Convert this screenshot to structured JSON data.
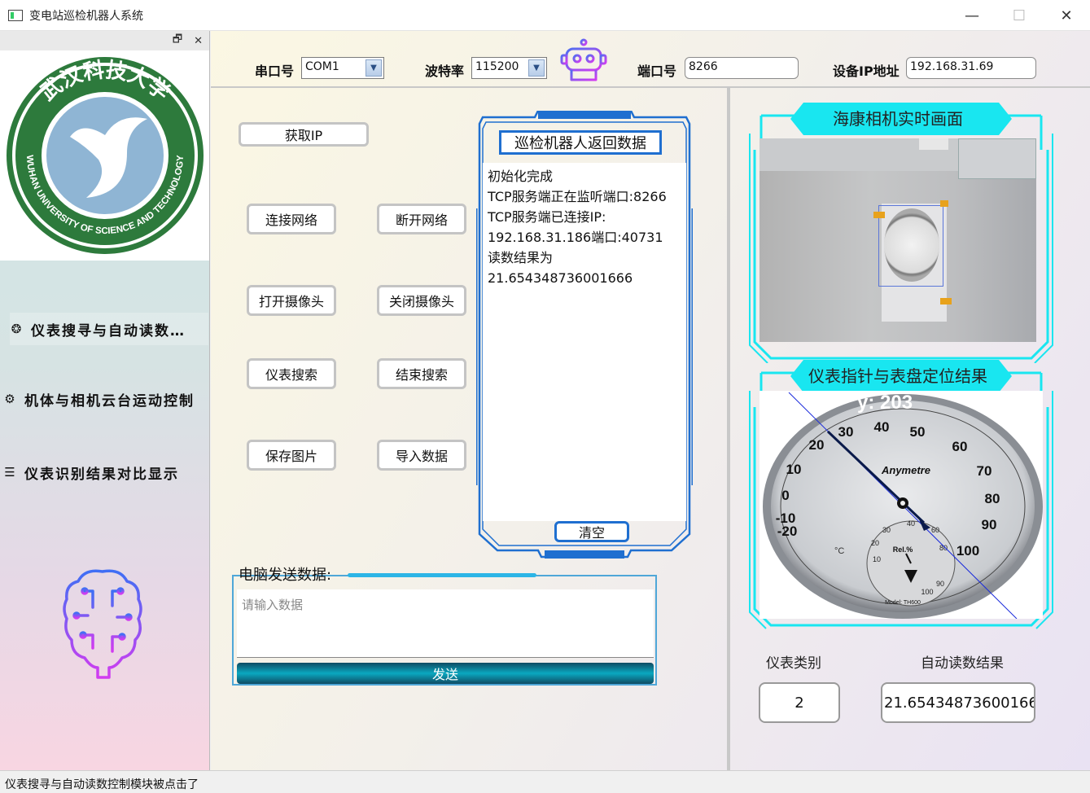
{
  "window": {
    "title": "变电站巡检机器人系统",
    "minimize": "—",
    "maximize": "☐",
    "close": "✕"
  },
  "sidebar": {
    "dock_restore": "🗗",
    "dock_close": "✕",
    "logo": {
      "top_text": "武汉科技大学",
      "ring_text": "WUHAN UNIVERSITY OF SCIENCE AND TECHNOLOGY"
    },
    "items": [
      {
        "label": "仪表搜寻与自动读数…",
        "icon": "brain-chip-icon",
        "glyph": "❂"
      },
      {
        "label": "机体与相机云台运动控制",
        "icon": "gears-icon",
        "glyph": "⚙"
      },
      {
        "label": "仪表识别结果对比显示",
        "icon": "list-icon",
        "glyph": "☰"
      }
    ]
  },
  "topbar": {
    "serial_label": "串口号",
    "serial_value": "COM1",
    "baud_label": "波特率",
    "baud_value": "115200",
    "port_label": "端口号",
    "port_value": "8266",
    "ip_label": "设备IP地址",
    "ip_value": "192.168.31.69"
  },
  "controls": {
    "get_ip": "获取IP",
    "connect": "连接网络",
    "disconnect": "断开网络",
    "open_camera": "打开摄像头",
    "close_camera": "关闭摄像头",
    "search_meter": "仪表搜索",
    "stop_search": "结束搜索",
    "save_image": "保存图片",
    "import_data": "导入数据"
  },
  "return_data": {
    "title": "巡检机器人返回数据",
    "lines": [
      "初始化完成",
      "TCP服务端正在监听端口:8266",
      "TCP服务端已连接IP:",
      "192.168.31.186端口:40731",
      "读数结果为",
      "21.654348736001666"
    ],
    "clear": "清空"
  },
  "send": {
    "label": "电脑发送数据:",
    "placeholder": "请输入数据",
    "button": "发送"
  },
  "camera": {
    "title": "海康相机实时画面"
  },
  "dial": {
    "title": "仪表指针与表盘定位结果",
    "overlay": "y:   203",
    "brand": "Anymetre",
    "humidity_label": "Rel.%",
    "model": "Model: TH600",
    "outer_ticks": [
      "-20",
      "-10",
      "0",
      "10",
      "20",
      "30",
      "40",
      "50",
      "60",
      "70",
      "80",
      "90",
      "100"
    ],
    "unit": "°C",
    "inner_ticks": [
      "10",
      "20",
      "30",
      "40",
      "60",
      "80",
      "90",
      "100"
    ]
  },
  "results": {
    "type_label": "仪表类别",
    "reading_label": "自动读数结果",
    "type_value": "2",
    "reading_value": "21.654348736001666"
  },
  "status": {
    "message": "仪表搜寻与自动读数控制模块被点击了"
  }
}
